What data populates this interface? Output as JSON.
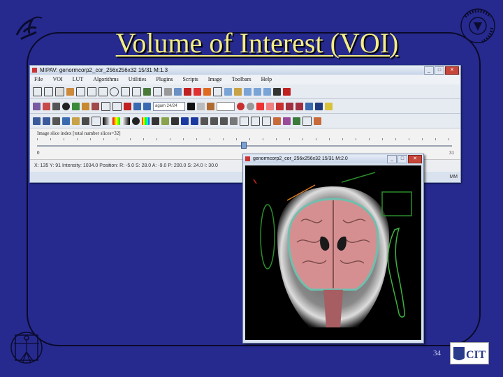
{
  "slide": {
    "title": "Volume of Interest (VOI)",
    "page_number": "34",
    "background_color": "#262a8e",
    "title_color": "#f4ee86"
  },
  "logos": {
    "hhs": "hhs-eagle-logo",
    "nih": "national-institutes-of-health-seal",
    "vitruvian": "vitruvian-man-logo",
    "cit": "CIT"
  },
  "mipav_window": {
    "title": "MIPAV: genormcorp2_cor_256x256x32   15/31 M:1.3",
    "menu": [
      "File",
      "VOI",
      "LUT",
      "Algorithms",
      "Utilities",
      "Plugins",
      "Scripts",
      "Image",
      "Toolbars",
      "Help"
    ],
    "combo_value": "agam 24/24",
    "slice_label": "Image slice index  [total number slices=32]",
    "slice_min": "0",
    "slice_max": "31",
    "slice_value": 15,
    "status": "X: 135  Y: 91  Intensity: 1034.0  Position: R: -5.0  S: 28.0  A: -9.0  P: 200.0  S: 24.0  I: 30.0",
    "right_label": "MM"
  },
  "image_window": {
    "title": "genormcorp2_cor_256x256x32   15/31 M:2.0",
    "voi_colors": [
      "#d32020",
      "#e07a20",
      "#2a8c2a",
      "#3fb33f"
    ]
  }
}
